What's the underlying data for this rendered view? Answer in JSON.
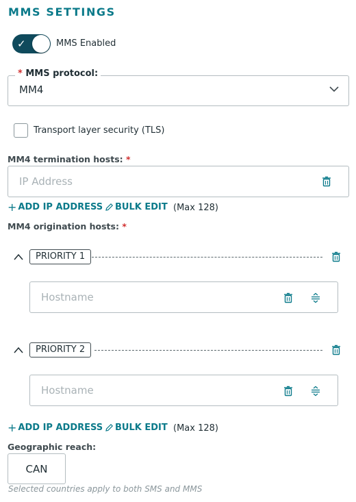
{
  "section": {
    "title": "MMS SETTINGS"
  },
  "mms_toggle": {
    "label": "MMS Enabled",
    "enabled": true
  },
  "protocol": {
    "label": "MMS protocol:",
    "required_mark": "*",
    "value": "MM4"
  },
  "tls": {
    "label": "Transport layer security (TLS)",
    "checked": false
  },
  "termination": {
    "label": "MM4 termination hosts:",
    "required_mark": "*",
    "placeholder": "IP Address",
    "add_label": "ADD IP ADDRESS",
    "bulk_label": "BULK EDIT",
    "max_note": "(Max 128)"
  },
  "origination": {
    "label": "MM4 origination hosts:",
    "required_mark": "*",
    "priorities": [
      {
        "label": "PRIORITY 1",
        "placeholder": "Hostname"
      },
      {
        "label": "PRIORITY 2",
        "placeholder": "Hostname"
      }
    ],
    "add_label": "ADD IP ADDRESS",
    "bulk_label": "BULK EDIT",
    "max_note": "(Max 128)"
  },
  "geo": {
    "label": "Geographic reach:",
    "value": "CAN",
    "helper": "Selected countries apply to both SMS and MMS"
  },
  "colors": {
    "accent": "#0b7a8a",
    "toggle_on": "#0f4a5c",
    "required": "#d12f2f"
  }
}
